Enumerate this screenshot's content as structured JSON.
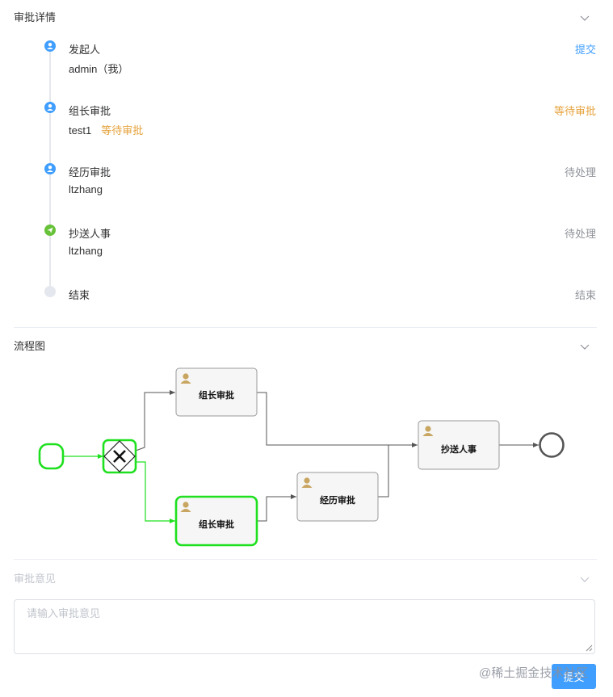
{
  "approval_section": {
    "title": "审批详情",
    "steps": [
      {
        "icon": "user-icon",
        "title": "发起人",
        "subtitle": "admin（我）",
        "tag": "",
        "status": "提交",
        "status_color": "#409eff",
        "node_color": "#409eff"
      },
      {
        "icon": "user-icon",
        "title": "组长审批",
        "subtitle": "test1",
        "tag": "等待审批",
        "status": "等待审批",
        "status_color": "#e6a23c",
        "node_color": "#409eff"
      },
      {
        "icon": "user-icon",
        "title": "经历审批",
        "subtitle": "ltzhang",
        "tag": "",
        "status": "待处理",
        "status_color": "#909399",
        "node_color": "#409eff"
      },
      {
        "icon": "send-icon",
        "title": "抄送人事",
        "subtitle": "ltzhang",
        "tag": "",
        "status": "待处理",
        "status_color": "#909399",
        "node_color": "#67c23a"
      },
      {
        "icon": "",
        "title": "结束",
        "subtitle": "",
        "tag": "",
        "status": "结束",
        "status_color": "#909399",
        "node_color": "#e4e7ed"
      }
    ]
  },
  "flow_section": {
    "title": "流程图",
    "tasks": {
      "leader_top": "组长审批",
      "leader_bottom": "组长审批",
      "manager": "经历审批",
      "hr_cc": "抄送人事"
    },
    "highlight_color": "#1ee01e"
  },
  "opinion_section": {
    "title": "审批意见",
    "placeholder": "请输入审批意见"
  },
  "watermark": "@稀土掘金技术社区",
  "submit_button": "提交"
}
